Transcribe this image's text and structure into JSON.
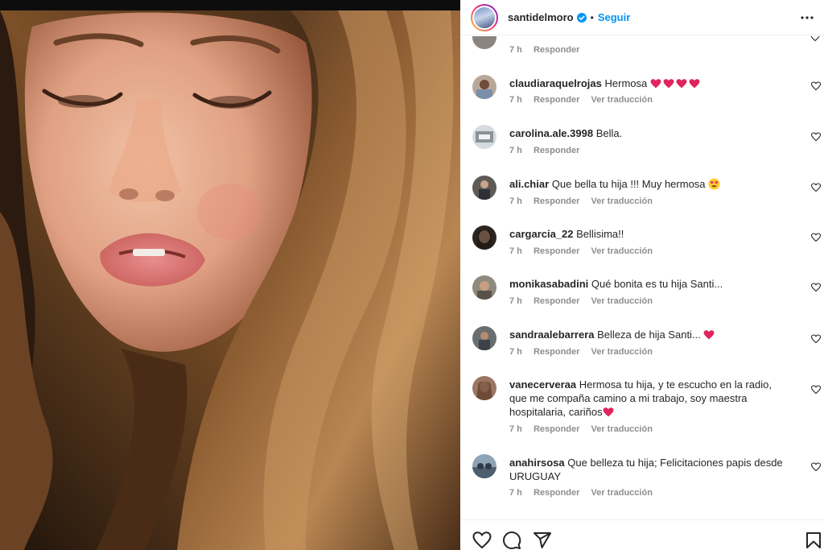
{
  "header": {
    "username": "santidelmoro",
    "separator": "•",
    "follow_label": "Seguir"
  },
  "cut_comment": {
    "text": "",
    "time": "7 h",
    "reply_label": "Responder"
  },
  "comments": [
    {
      "username": "claudiaraquelrojas",
      "text": "Hermosa",
      "emoji": "four-red-hearts",
      "time": "7 h",
      "reply_label": "Responder",
      "translate_label": "Ver traducción"
    },
    {
      "username": "carolina.ale.3998",
      "text": "Bella.",
      "time": "7 h",
      "reply_label": "Responder"
    },
    {
      "username": "ali.chiar",
      "text": "Que bella tu hija !!! Muy hermosa",
      "emoji": "heart-eyes-face",
      "time": "7 h",
      "reply_label": "Responder",
      "translate_label": "Ver traducción"
    },
    {
      "username": "cargarcia_22",
      "text": "Bellisima!!",
      "time": "7 h",
      "reply_label": "Responder",
      "translate_label": "Ver traducción"
    },
    {
      "username": "monikasabadini",
      "text": "Qué bonita es tu hija Santi...",
      "time": "7 h",
      "reply_label": "Responder",
      "translate_label": "Ver traducción"
    },
    {
      "username": "sandraalebarrera",
      "text": "Belleza de hija Santi...",
      "emoji": "red-heart",
      "time": "7 h",
      "reply_label": "Responder",
      "translate_label": "Ver traducción"
    },
    {
      "username": "vanecerveraa",
      "text": "Hermosa tu hija, y te escucho en la radio, que me compaña camino a mi trabajo, soy maestra hospitalaria, cariños",
      "emoji": "red-heart",
      "time": "7 h",
      "reply_label": "Responder",
      "translate_label": "Ver traducción"
    },
    {
      "username": "anahirsosa",
      "text": "Que belleza tu hija; Felicitaciones papis desde URUGUAY",
      "time": "7 h",
      "reply_label": "Responder",
      "translate_label": "Ver traducción"
    }
  ],
  "icons": {
    "verified": "verified-badge-icon",
    "more": "more-options-icon",
    "comment_like": "heart-outline-icon",
    "like": "heart-outline-icon",
    "comment": "comment-bubble-icon",
    "share": "paper-plane-icon",
    "save": "bookmark-icon"
  },
  "colors": {
    "link_blue": "#0095f6",
    "text": "#262626",
    "secondary_text": "#8e8e8e",
    "emoji_red": "#e0245e"
  }
}
